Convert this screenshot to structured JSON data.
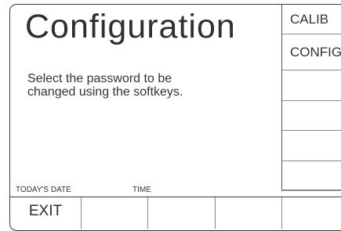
{
  "screen": {
    "title": "Configuration",
    "message_line1": "Select the password to be",
    "message_line2": "changed using the softkeys.",
    "date_label": "TODAY'S DATE",
    "time_label": "TIME"
  },
  "side_softkeys": [
    {
      "label": "CALIB"
    },
    {
      "label": "CONFIG"
    },
    {
      "label": ""
    },
    {
      "label": ""
    },
    {
      "label": ""
    },
    {
      "label": ""
    }
  ],
  "bottom_softkeys": [
    {
      "label": "EXIT"
    },
    {
      "label": ""
    },
    {
      "label": ""
    },
    {
      "label": ""
    },
    {
      "label": ""
    }
  ]
}
